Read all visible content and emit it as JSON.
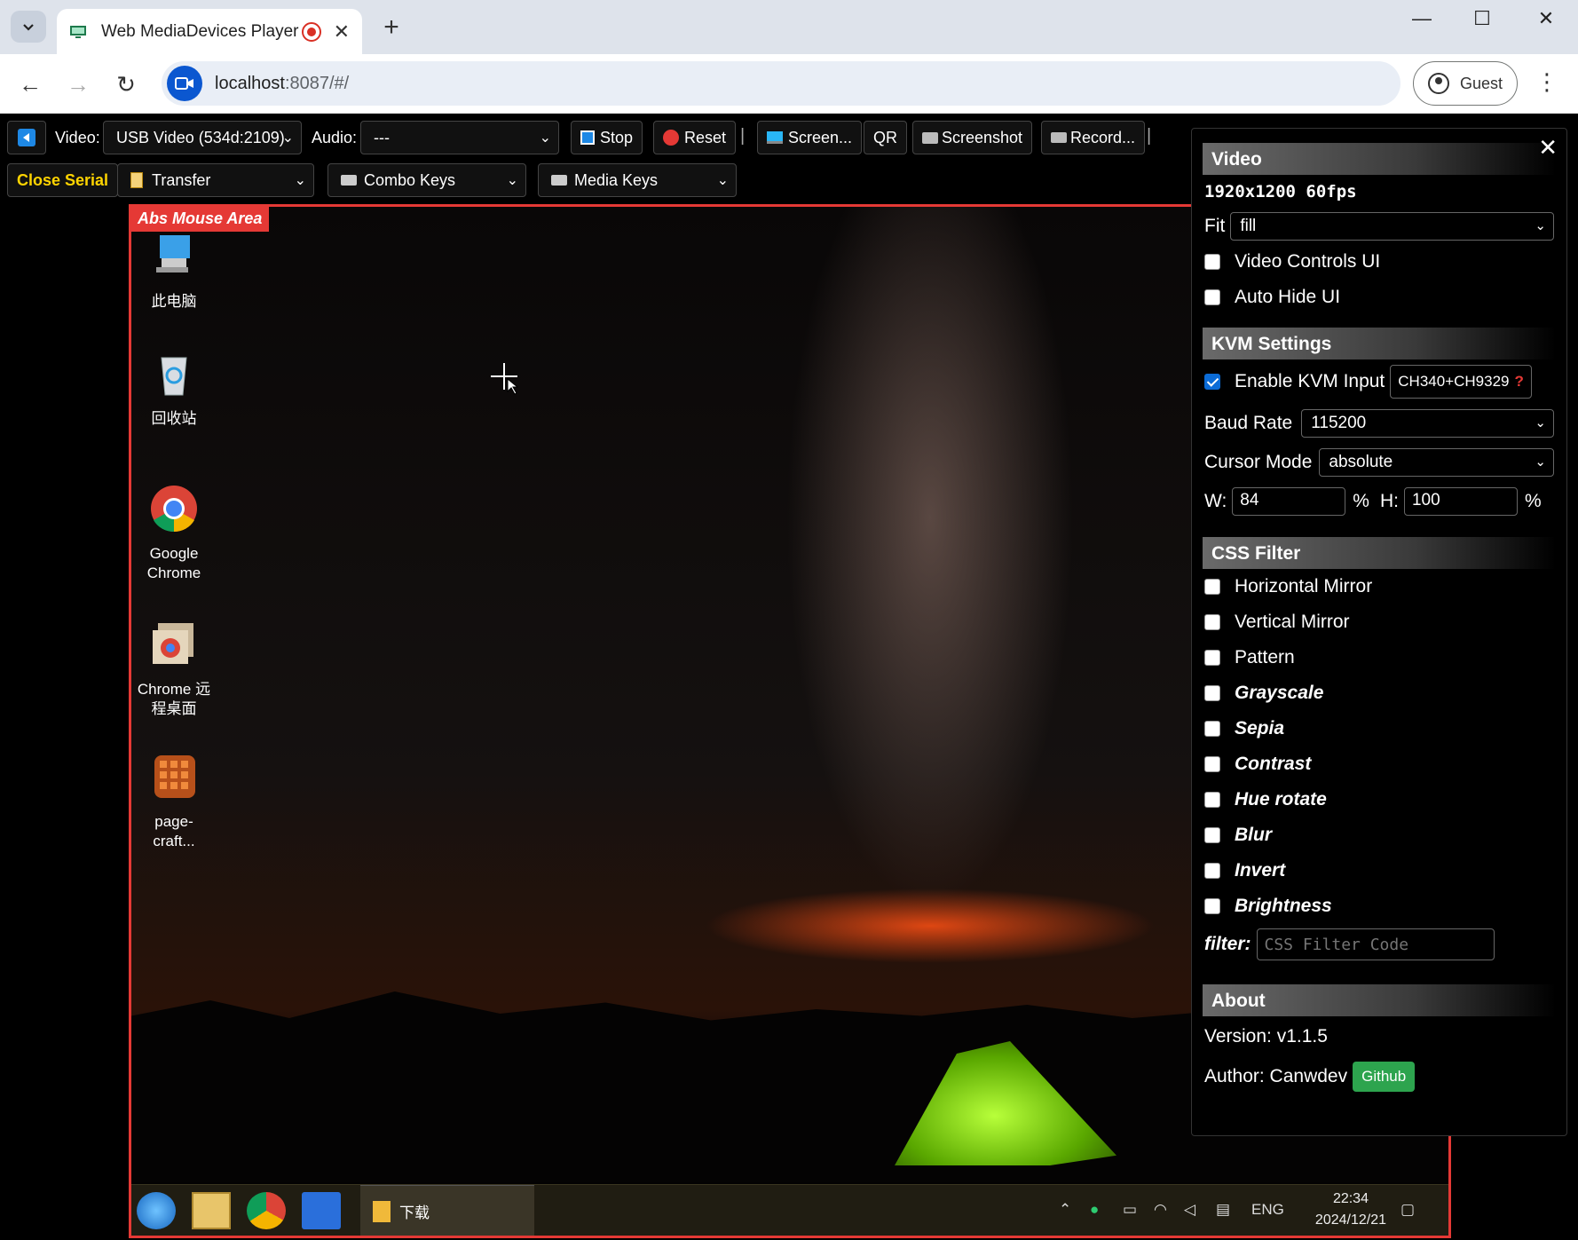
{
  "browser": {
    "tab_title": "Web MediaDevices Player",
    "url_host": "localhost",
    "url_rest": ":8087/#/",
    "profile_label": "Guest"
  },
  "toolbar": {
    "video_label": "Video:",
    "video_select": "USB Video (534d:2109)",
    "audio_label": "Audio:",
    "audio_select": "---",
    "stop": "Stop",
    "reset": "Reset",
    "screen": "Screen...",
    "qr": "QR",
    "screenshot": "Screenshot",
    "record": "Record...",
    "close_serial": "Close Serial",
    "transfer": "Transfer",
    "combo_keys": "Combo Keys",
    "media_keys": "Media Keys",
    "separator": "|"
  },
  "remote": {
    "abs_mouse_area": "Abs Mouse Area",
    "desktop_icons": [
      {
        "name": "此电脑",
        "icon": "computer-icon"
      },
      {
        "name": "回收站",
        "icon": "recycle-bin-icon"
      },
      {
        "name": "Google Chrome",
        "icon": "chrome-icon"
      },
      {
        "name": "Chrome 远程桌面",
        "icon": "chrome-remote-desktop-icon"
      },
      {
        "name": "page-craft...",
        "icon": "page-craft-icon"
      }
    ],
    "taskbar": {
      "active_item": "下载",
      "lang": "ENG",
      "time": "22:34",
      "date": "2024/12/21"
    }
  },
  "panel": {
    "video_section": "Video",
    "resolution": "1920x1200 60fps",
    "fit_label": "Fit",
    "fit_value": "fill",
    "video_controls_ui": "Video Controls UI",
    "auto_hide_ui": "Auto Hide UI",
    "kvm_section": "KVM Settings",
    "enable_kvm": "Enable KVM Input",
    "kvm_device": "CH340+CH9329",
    "baud_label": "Baud Rate",
    "baud_value": "115200",
    "cursor_label": "Cursor Mode",
    "cursor_value": "absolute",
    "w_label": "W:",
    "w_value": "84",
    "h_label": "H:",
    "h_value": "100",
    "percent": "%",
    "css_section": "CSS Filter",
    "filters": [
      "Horizontal Mirror",
      "Vertical Mirror",
      "Pattern",
      "Grayscale",
      "Sepia",
      "Contrast",
      "Hue rotate",
      "Blur",
      "Invert",
      "Brightness"
    ],
    "filter_label": "filter:",
    "filter_placeholder": "CSS Filter Code",
    "about_section": "About",
    "version": "Version: v1.1.5",
    "author": "Author: Canwdev",
    "github": "Github",
    "kvm_enabled": true
  }
}
